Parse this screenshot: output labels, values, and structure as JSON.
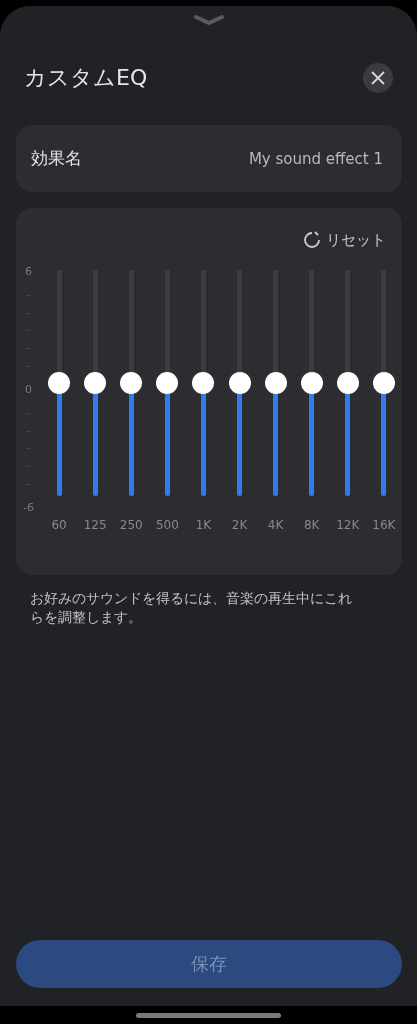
{
  "sheet": {
    "title": "カスタムEQ"
  },
  "effect_name": {
    "label": "効果名",
    "value": "My sound effect 1"
  },
  "equalizer": {
    "reset": "リセット",
    "axis_labels": [
      "6",
      "0",
      "-6"
    ],
    "bands": [
      {
        "label": "60",
        "level": 0.5
      },
      {
        "label": "125",
        "level": 0.5
      },
      {
        "label": "250",
        "level": 0.5
      },
      {
        "label": "500",
        "level": 0.5
      },
      {
        "label": "1K",
        "level": 0.5
      },
      {
        "label": "2K",
        "level": 0.5
      },
      {
        "label": "4K",
        "level": 0.5
      },
      {
        "label": "8K",
        "level": 0.5
      },
      {
        "label": "12K",
        "level": 0.5
      },
      {
        "label": "16K",
        "level": 0.5
      }
    ]
  },
  "hint": "お好みのサウンドを得るには、音楽の再生中にこれらを調整します。",
  "save_button": {
    "label": "保存",
    "disabled": true
  }
}
